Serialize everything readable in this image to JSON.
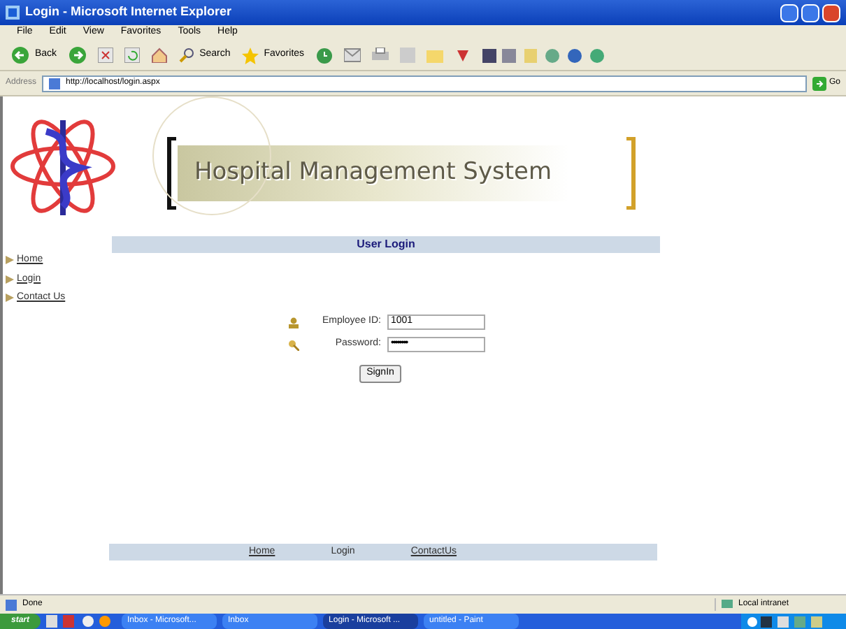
{
  "window": {
    "title": "Login - Microsoft Internet Explorer"
  },
  "menu": [
    "File",
    "Edit",
    "View",
    "Favorites",
    "Tools",
    "Help"
  ],
  "toolbar": {
    "back": "Back",
    "search": "Search",
    "favorites": "Favorites"
  },
  "address": {
    "label": "Address",
    "url": "http://localhost/login.aspx",
    "go": "Go"
  },
  "banner": {
    "title": "Hospital Management System"
  },
  "sidebar": {
    "items": [
      "Home",
      "Login",
      "Contact Us"
    ]
  },
  "login": {
    "header": "User Login",
    "fields": [
      {
        "label": "Employee ID:",
        "value": "1001",
        "kind": "text"
      },
      {
        "label": "Password:",
        "value": "••••••••",
        "kind": "password"
      }
    ],
    "button": "SignIn"
  },
  "footer": {
    "links": [
      "Home",
      "Login",
      "ContactUs"
    ]
  },
  "status_bar": {
    "text": "Done",
    "zone": "Local intranet"
  },
  "taskbar": {
    "start": "start",
    "tasks": [
      {
        "label": "Inbox - Microsoft...",
        "selected": false
      },
      {
        "label": "Inbox",
        "selected": false
      },
      {
        "label": "Login - Microsoft ...",
        "selected": true
      },
      {
        "label": "untitled - Paint",
        "selected": false
      }
    ]
  }
}
